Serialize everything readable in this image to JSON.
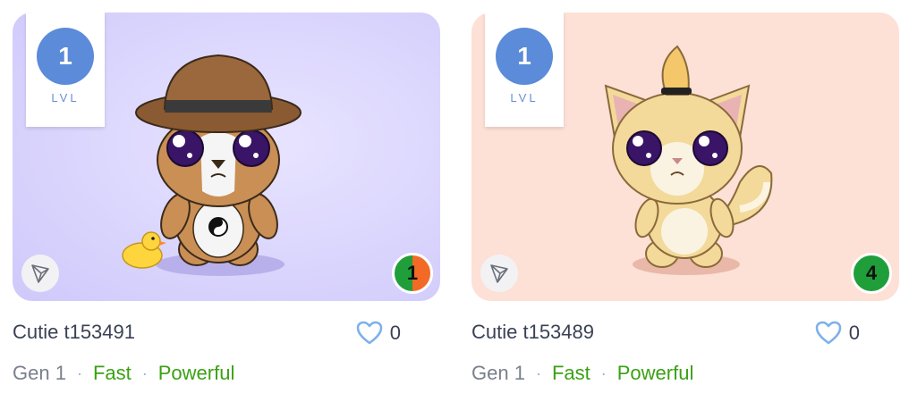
{
  "cards": [
    {
      "level": "1",
      "level_label": "LVL",
      "badge_value": "1",
      "name": "Cutie t153491",
      "likes": "0",
      "gen": "Gen 1",
      "trait1": "Fast",
      "trait2": "Powerful",
      "icons": {
        "network": "tron-icon",
        "like": "heart-icon"
      }
    },
    {
      "level": "1",
      "level_label": "LVL",
      "badge_value": "4",
      "name": "Cutie t153489",
      "likes": "0",
      "gen": "Gen 1",
      "trait1": "Fast",
      "trait2": "Powerful",
      "icons": {
        "network": "tron-icon",
        "like": "heart-icon"
      }
    }
  ],
  "colors": {
    "level": "#5b8bd9",
    "trait": "#3aa113",
    "heart": "#7db0ec"
  }
}
